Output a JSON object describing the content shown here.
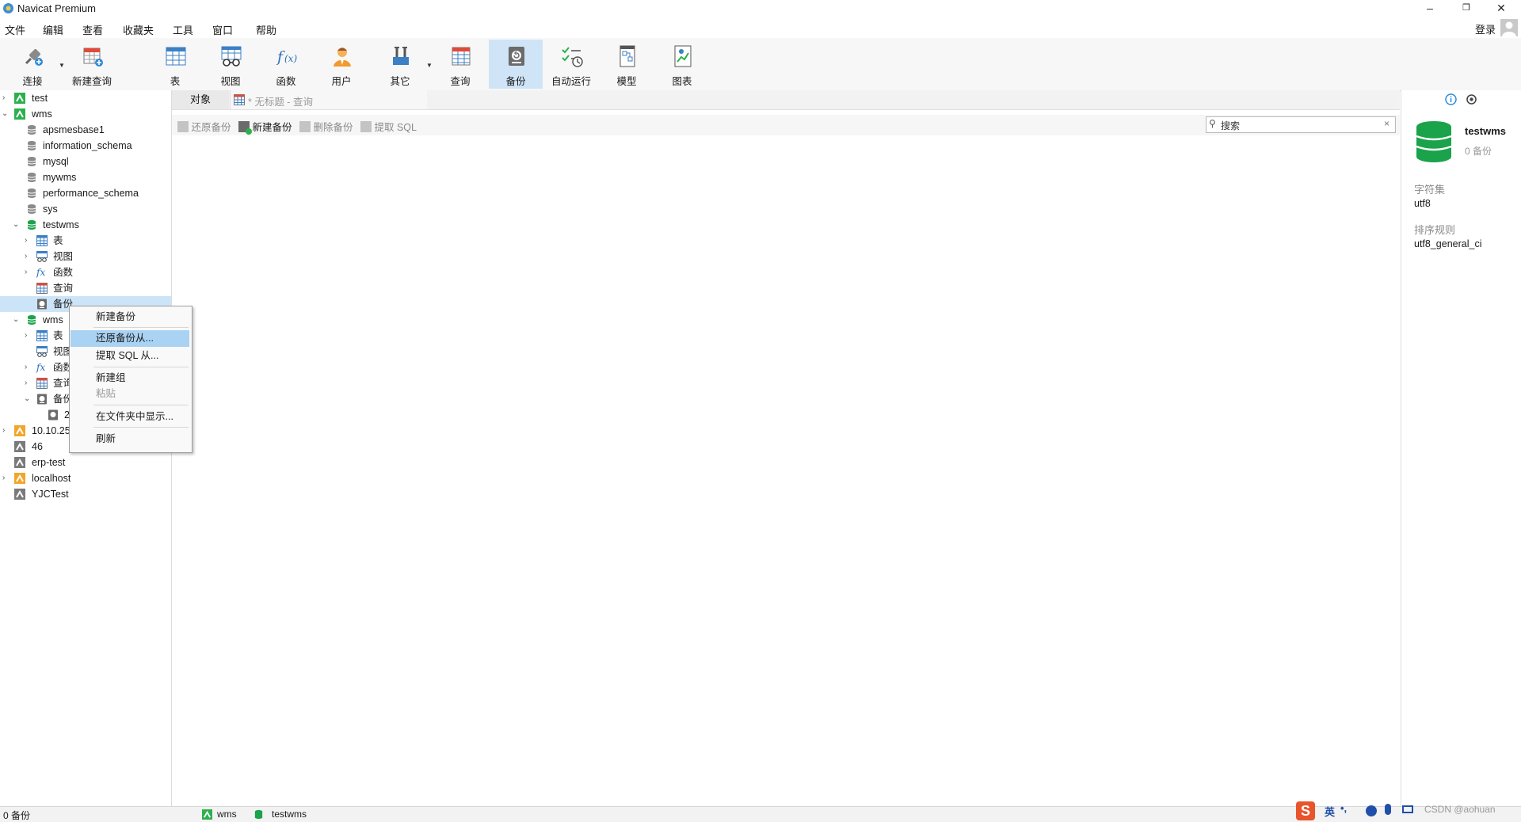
{
  "window": {
    "title": "Navicat Premium",
    "minimize": "–",
    "restore": "❐",
    "close": "✕"
  },
  "menu": [
    "文件",
    "编辑",
    "查看",
    "收藏夹",
    "工具",
    "窗口",
    "帮助"
  ],
  "login": "登录",
  "toolbar": {
    "connect": "连接",
    "new_query": "新建查询",
    "table": "表",
    "view": "视图",
    "function": "函数",
    "user": "用户",
    "other": "其它",
    "query": "查询",
    "backup": "备份",
    "automation": "自动运行",
    "model": "模型",
    "chart": "图表"
  },
  "tree": {
    "test": "test",
    "wms": "wms",
    "apsmesbase1": "apsmesbase1",
    "information_schema": "information_schema",
    "mysql": "mysql",
    "mywms": "mywms",
    "performance_schema": "performance_schema",
    "sys": "sys",
    "testwms": "testwms",
    "tw_table": "表",
    "tw_view": "视图",
    "tw_function": "函数",
    "tw_query": "查询",
    "tw_backup": "备份",
    "wms_db": "wms",
    "w_table": "表",
    "w_view": "视图",
    "w_function": "函数",
    "w_query": "查询",
    "w_backup": "备份",
    "w_backup_child": "2",
    "conn_ip": "10.10.25",
    "conn_46": "46",
    "erp_test": "erp-test",
    "localhost": "localhost",
    "yjctest": "YJCTest"
  },
  "tabs": {
    "objects": "对象",
    "untitled": "* 无标题 - 查询"
  },
  "backup_toolbar": {
    "restore": "还原备份",
    "new": "新建备份",
    "delete": "删除备份",
    "extract": "提取 SQL"
  },
  "search": {
    "placeholder": "搜索",
    "clear": "×"
  },
  "info": {
    "db_name": "testwms",
    "backup_count": "0 备份",
    "charset_label": "字符集",
    "charset": "utf8",
    "collation_label": "排序规则",
    "collation": "utf8_general_ci"
  },
  "context_menu": {
    "new_backup": "新建备份",
    "restore_from": "还原备份从...",
    "extract_sql": "提取 SQL 从...",
    "new_group": "新建组",
    "paste": "粘贴",
    "show_in_folder": "在文件夹中显示...",
    "refresh": "刷新"
  },
  "status": {
    "count": "0 备份",
    "conn": "wms",
    "db": "testwms"
  },
  "tray": {
    "ime": "英",
    "punct": "•,",
    "watermark": "CSDN @aohuan"
  },
  "colors": {
    "accent": "#cfe4f6",
    "highlight": "#a9d2f3",
    "db_green": "#1aa34a",
    "conn_green": "#2bb14b"
  }
}
